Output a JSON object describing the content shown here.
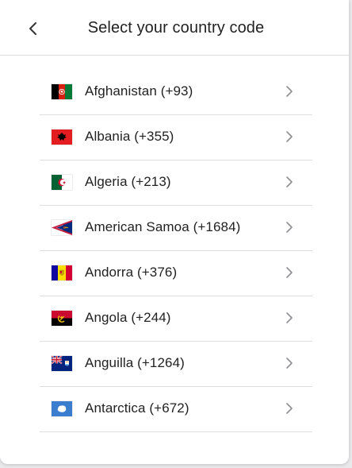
{
  "header": {
    "title": "Select your country code",
    "back_icon": "chevron-left-icon"
  },
  "countries": [
    {
      "label": "Afghanistan (+93)",
      "flag": "afghanistan-flag-icon"
    },
    {
      "label": "Albania (+355)",
      "flag": "albania-flag-icon"
    },
    {
      "label": "Algeria (+213)",
      "flag": "algeria-flag-icon"
    },
    {
      "label": "American Samoa (+1684)",
      "flag": "american-samoa-flag-icon"
    },
    {
      "label": "Andorra (+376)",
      "flag": "andorra-flag-icon"
    },
    {
      "label": "Angola (+244)",
      "flag": "angola-flag-icon"
    },
    {
      "label": "Anguilla (+1264)",
      "flag": "anguilla-flag-icon"
    },
    {
      "label": "Antarctica (+672)",
      "flag": "antarctica-flag-icon"
    }
  ],
  "row_icon": "chevron-right-icon",
  "colors": {
    "text": "#222222",
    "divider": "#dedede",
    "chevron": "#8e8e93"
  }
}
